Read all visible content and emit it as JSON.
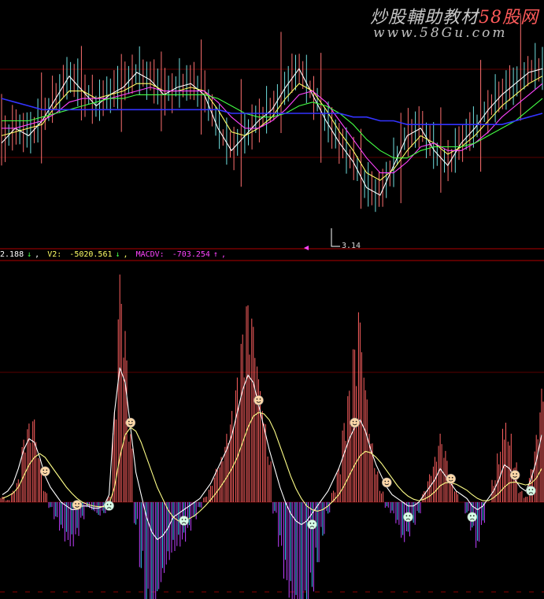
{
  "watermark": {
    "title_main": "炒股輔助教材",
    "title_accent": "58股网",
    "url": "www.58Gu.com"
  },
  "price_panel": {
    "low_label": "3.14",
    "ma_colors": [
      "#ffffff",
      "#ffff66",
      "#ff44ff",
      "#44ff44",
      "#3333ff"
    ]
  },
  "indicator_legend": {
    "value1": "2.188",
    "value1_arrow": "↓",
    "v2_label": "V2:",
    "v2_value": "-5020.561",
    "v2_arrow": "↓",
    "macdv_label": "MACDV:",
    "macdv_value": "-703.254",
    "macdv_arrow": "↑",
    "colors": {
      "value1": "#ffffff",
      "v2": "#ffff66",
      "macdv": "#ff44ff",
      "up": "#ff44ff",
      "down": "#44ff44"
    }
  },
  "chart_data": [
    {
      "type": "candlestick",
      "panel": "price",
      "note": "Daily price bars with moving averages; lowest marked price",
      "low_marker": 3.14,
      "series": [
        {
          "name": "",
          "color": "#ffffff",
          "values": [
            0.8,
            0.84,
            0.82,
            0.86,
            0.92,
            0.98,
            0.94,
            0.9,
            0.93,
            0.95,
            0.99,
            0.97,
            0.93,
            0.95,
            0.96,
            0.93,
            0.84,
            0.78,
            0.82,
            0.86,
            0.89,
            0.95,
            1.0,
            0.93,
            0.86,
            0.8,
            0.75,
            0.68,
            0.66,
            0.74,
            0.82,
            0.84,
            0.78,
            0.74,
            0.8,
            0.84,
            0.89,
            0.93,
            0.96,
            0.99,
            1.0
          ]
        },
        {
          "name": "",
          "color": "#ffff66",
          "values": [
            0.82,
            0.83,
            0.84,
            0.85,
            0.9,
            0.94,
            0.94,
            0.92,
            0.93,
            0.94,
            0.96,
            0.96,
            0.94,
            0.94,
            0.95,
            0.94,
            0.89,
            0.83,
            0.82,
            0.84,
            0.87,
            0.92,
            0.96,
            0.94,
            0.89,
            0.83,
            0.78,
            0.72,
            0.7,
            0.73,
            0.78,
            0.82,
            0.8,
            0.77,
            0.79,
            0.82,
            0.86,
            0.9,
            0.93,
            0.96,
            0.98
          ]
        },
        {
          "name": "",
          "color": "#ff44ff",
          "values": [
            0.84,
            0.84,
            0.85,
            0.86,
            0.88,
            0.91,
            0.92,
            0.92,
            0.92,
            0.93,
            0.94,
            0.95,
            0.94,
            0.94,
            0.94,
            0.94,
            0.91,
            0.87,
            0.84,
            0.84,
            0.86,
            0.89,
            0.93,
            0.94,
            0.91,
            0.86,
            0.81,
            0.76,
            0.72,
            0.72,
            0.75,
            0.79,
            0.8,
            0.78,
            0.78,
            0.8,
            0.83,
            0.87,
            0.9,
            0.93,
            0.96
          ]
        },
        {
          "name": "",
          "color": "#44ff44",
          "values": [
            0.86,
            0.86,
            0.86,
            0.87,
            0.88,
            0.89,
            0.9,
            0.91,
            0.92,
            0.92,
            0.93,
            0.93,
            0.93,
            0.93,
            0.93,
            0.93,
            0.92,
            0.9,
            0.88,
            0.87,
            0.87,
            0.88,
            0.9,
            0.91,
            0.9,
            0.88,
            0.85,
            0.81,
            0.78,
            0.76,
            0.76,
            0.78,
            0.79,
            0.79,
            0.79,
            0.8,
            0.82,
            0.84,
            0.86,
            0.89,
            0.92
          ]
        },
        {
          "name": "",
          "color": "#3333ff",
          "values": [
            0.92,
            0.91,
            0.9,
            0.89,
            0.89,
            0.89,
            0.89,
            0.89,
            0.89,
            0.89,
            0.89,
            0.89,
            0.89,
            0.89,
            0.89,
            0.89,
            0.89,
            0.88,
            0.88,
            0.88,
            0.88,
            0.88,
            0.88,
            0.88,
            0.88,
            0.88,
            0.87,
            0.87,
            0.86,
            0.86,
            0.85,
            0.85,
            0.85,
            0.85,
            0.85,
            0.85,
            0.85,
            0.85,
            0.86,
            0.87,
            0.88
          ]
        }
      ]
    },
    {
      "type": "bar",
      "panel": "indicator",
      "note": "MACD-style histogram with two signal lines and smiley/frown markers",
      "histogram": [
        5,
        2,
        10,
        20,
        55,
        70,
        75,
        40,
        10,
        -5,
        -15,
        -25,
        -35,
        -40,
        -30,
        -15,
        -5,
        -8,
        -12,
        -10,
        5,
        80,
        200,
        150,
        60,
        -20,
        -60,
        -100,
        -110,
        -90,
        -70,
        -55,
        -45,
        -40,
        -35,
        -25,
        -15,
        -5,
        5,
        15,
        30,
        40,
        60,
        80,
        110,
        150,
        180,
        165,
        120,
        80,
        40,
        -10,
        -40,
        -70,
        -90,
        -100,
        -110,
        -95,
        -80,
        -55,
        -30,
        -10,
        10,
        30,
        70,
        100,
        140,
        170,
        110,
        60,
        30,
        10,
        -5,
        -10,
        -20,
        -35,
        -30,
        -20,
        -10,
        10,
        25,
        40,
        60,
        45,
        25,
        10,
        0,
        -10,
        -25,
        -40,
        -20,
        0,
        20,
        45,
        70,
        60,
        35,
        10,
        5,
        30,
        60,
        100
      ],
      "series": [
        {
          "name": "",
          "color": "#ffffff",
          "values": [
            10,
            15,
            25,
            45,
            70,
            85,
            80,
            60,
            35,
            20,
            10,
            0,
            -5,
            -10,
            -10,
            -5,
            -5,
            -8,
            -8,
            -5,
            10,
            120,
            180,
            160,
            100,
            40,
            10,
            -20,
            -40,
            -50,
            -45,
            -35,
            -20,
            -15,
            -10,
            -5,
            0,
            5,
            15,
            25,
            40,
            55,
            70,
            90,
            120,
            150,
            170,
            160,
            130,
            100,
            70,
            45,
            20,
            0,
            -15,
            -25,
            -30,
            -25,
            -15,
            -5,
            5,
            15,
            30,
            45,
            65,
            85,
            100,
            110,
            95,
            70,
            50,
            35,
            20,
            10,
            5,
            0,
            -5,
            -5,
            0,
            10,
            20,
            30,
            45,
            35,
            25,
            15,
            10,
            5,
            -5,
            -10,
            -5,
            5,
            15,
            30,
            50,
            45,
            30,
            20,
            15,
            30,
            55,
            90
          ]
        },
        {
          "name": "",
          "color": "#ffff88",
          "values": [
            5,
            8,
            12,
            20,
            35,
            50,
            60,
            65,
            60,
            50,
            40,
            30,
            20,
            12,
            5,
            0,
            -3,
            -5,
            -6,
            -6,
            -3,
            20,
            60,
            90,
            100,
            95,
            80,
            60,
            40,
            20,
            5,
            -10,
            -20,
            -25,
            -25,
            -22,
            -18,
            -12,
            -5,
            3,
            12,
            22,
            33,
            45,
            60,
            80,
            100,
            115,
            120,
            118,
            110,
            95,
            75,
            55,
            35,
            18,
            5,
            -5,
            -10,
            -12,
            -10,
            -5,
            2,
            10,
            22,
            36,
            50,
            62,
            68,
            66,
            60,
            52,
            42,
            32,
            22,
            14,
            8,
            4,
            2,
            4,
            8,
            14,
            22,
            26,
            26,
            24,
            20,
            16,
            10,
            5,
            2,
            2,
            6,
            12,
            20,
            26,
            27,
            25,
            23,
            25,
            32,
            45
          ]
        }
      ],
      "markers": [
        {
          "type": "smile",
          "index": 8
        },
        {
          "type": "smile",
          "index": 14
        },
        {
          "type": "frown",
          "index": 20
        },
        {
          "type": "smile",
          "index": 24
        },
        {
          "type": "frown",
          "index": 34
        },
        {
          "type": "smile",
          "index": 48
        },
        {
          "type": "frown",
          "index": 58
        },
        {
          "type": "smile",
          "index": 66
        },
        {
          "type": "smile",
          "index": 72
        },
        {
          "type": "frown",
          "index": 76
        },
        {
          "type": "smile",
          "index": 84
        },
        {
          "type": "frown",
          "index": 88
        },
        {
          "type": "smile",
          "index": 96
        },
        {
          "type": "frown",
          "index": 99
        }
      ]
    }
  ]
}
